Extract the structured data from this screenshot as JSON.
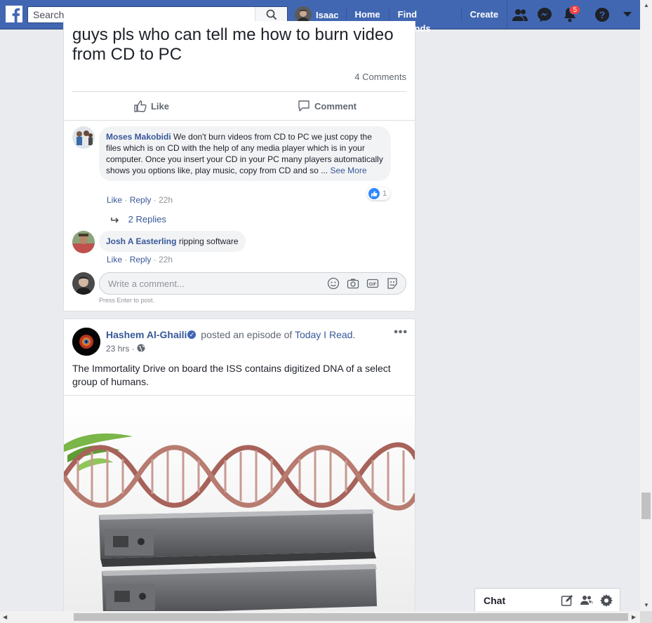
{
  "topbar": {
    "search_placeholder": "Search",
    "profile_name": "Isaac",
    "links": [
      "Home",
      "Find Friends",
      "Create"
    ],
    "notification_count": "5"
  },
  "post1": {
    "text": "guys pls who can tell me how to burn video from CD to PC",
    "comments_count": "4 Comments",
    "like_label": "Like",
    "comment_label": "Comment",
    "comments": [
      {
        "author": "Moses Makobidi",
        "text": "We don't burn videos from CD to PC we just copy the files which is on CD with the help of any media player which is in your computer. Once you insert your CD in your PC many players automatically shows you options like, play music, copy from CD and so ...",
        "see_more": "See More",
        "reaction_count": "1",
        "like": "Like",
        "reply": "Reply",
        "time": "22h"
      },
      {
        "author": "Josh A Easterling",
        "text": "ripping software",
        "like": "Like",
        "reply": "Reply",
        "time": "22h"
      }
    ],
    "replies_label": "2 Replies",
    "write_placeholder": "Write a comment...",
    "hint": "Press Enter to post."
  },
  "post2": {
    "author": "Hashem Al-Ghaili",
    "action": "posted an episode of",
    "page": "Today I Read.",
    "time": "23 hrs",
    "text": "The Immortality Drive on board the ISS contains digitized DNA of a select group of humans."
  },
  "chat": {
    "label": "Chat"
  }
}
